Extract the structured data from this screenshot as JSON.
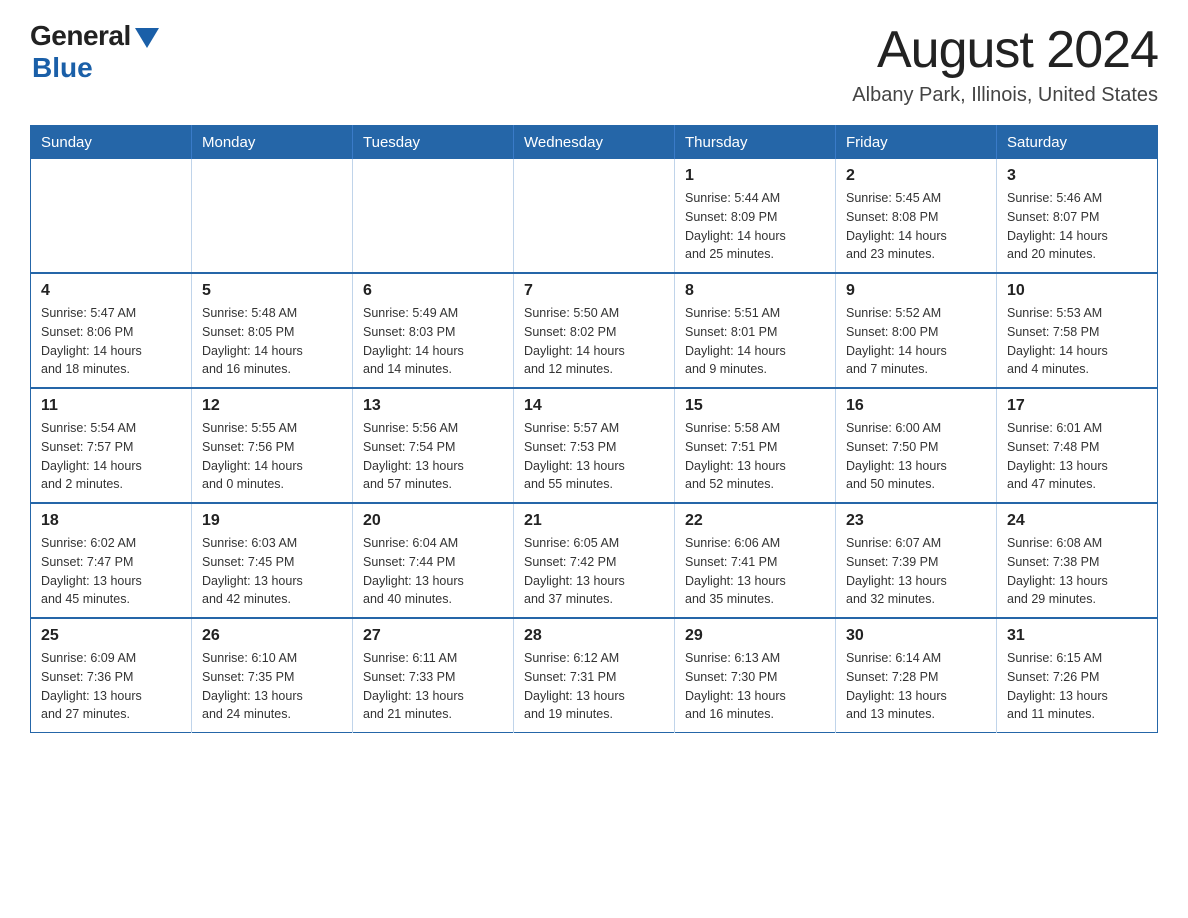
{
  "logo": {
    "general": "General",
    "blue": "Blue"
  },
  "title": "August 2024",
  "subtitle": "Albany Park, Illinois, United States",
  "weekdays": [
    "Sunday",
    "Monday",
    "Tuesday",
    "Wednesday",
    "Thursday",
    "Friday",
    "Saturday"
  ],
  "weeks": [
    [
      {
        "day": "",
        "info": ""
      },
      {
        "day": "",
        "info": ""
      },
      {
        "day": "",
        "info": ""
      },
      {
        "day": "",
        "info": ""
      },
      {
        "day": "1",
        "info": "Sunrise: 5:44 AM\nSunset: 8:09 PM\nDaylight: 14 hours\nand 25 minutes."
      },
      {
        "day": "2",
        "info": "Sunrise: 5:45 AM\nSunset: 8:08 PM\nDaylight: 14 hours\nand 23 minutes."
      },
      {
        "day": "3",
        "info": "Sunrise: 5:46 AM\nSunset: 8:07 PM\nDaylight: 14 hours\nand 20 minutes."
      }
    ],
    [
      {
        "day": "4",
        "info": "Sunrise: 5:47 AM\nSunset: 8:06 PM\nDaylight: 14 hours\nand 18 minutes."
      },
      {
        "day": "5",
        "info": "Sunrise: 5:48 AM\nSunset: 8:05 PM\nDaylight: 14 hours\nand 16 minutes."
      },
      {
        "day": "6",
        "info": "Sunrise: 5:49 AM\nSunset: 8:03 PM\nDaylight: 14 hours\nand 14 minutes."
      },
      {
        "day": "7",
        "info": "Sunrise: 5:50 AM\nSunset: 8:02 PM\nDaylight: 14 hours\nand 12 minutes."
      },
      {
        "day": "8",
        "info": "Sunrise: 5:51 AM\nSunset: 8:01 PM\nDaylight: 14 hours\nand 9 minutes."
      },
      {
        "day": "9",
        "info": "Sunrise: 5:52 AM\nSunset: 8:00 PM\nDaylight: 14 hours\nand 7 minutes."
      },
      {
        "day": "10",
        "info": "Sunrise: 5:53 AM\nSunset: 7:58 PM\nDaylight: 14 hours\nand 4 minutes."
      }
    ],
    [
      {
        "day": "11",
        "info": "Sunrise: 5:54 AM\nSunset: 7:57 PM\nDaylight: 14 hours\nand 2 minutes."
      },
      {
        "day": "12",
        "info": "Sunrise: 5:55 AM\nSunset: 7:56 PM\nDaylight: 14 hours\nand 0 minutes."
      },
      {
        "day": "13",
        "info": "Sunrise: 5:56 AM\nSunset: 7:54 PM\nDaylight: 13 hours\nand 57 minutes."
      },
      {
        "day": "14",
        "info": "Sunrise: 5:57 AM\nSunset: 7:53 PM\nDaylight: 13 hours\nand 55 minutes."
      },
      {
        "day": "15",
        "info": "Sunrise: 5:58 AM\nSunset: 7:51 PM\nDaylight: 13 hours\nand 52 minutes."
      },
      {
        "day": "16",
        "info": "Sunrise: 6:00 AM\nSunset: 7:50 PM\nDaylight: 13 hours\nand 50 minutes."
      },
      {
        "day": "17",
        "info": "Sunrise: 6:01 AM\nSunset: 7:48 PM\nDaylight: 13 hours\nand 47 minutes."
      }
    ],
    [
      {
        "day": "18",
        "info": "Sunrise: 6:02 AM\nSunset: 7:47 PM\nDaylight: 13 hours\nand 45 minutes."
      },
      {
        "day": "19",
        "info": "Sunrise: 6:03 AM\nSunset: 7:45 PM\nDaylight: 13 hours\nand 42 minutes."
      },
      {
        "day": "20",
        "info": "Sunrise: 6:04 AM\nSunset: 7:44 PM\nDaylight: 13 hours\nand 40 minutes."
      },
      {
        "day": "21",
        "info": "Sunrise: 6:05 AM\nSunset: 7:42 PM\nDaylight: 13 hours\nand 37 minutes."
      },
      {
        "day": "22",
        "info": "Sunrise: 6:06 AM\nSunset: 7:41 PM\nDaylight: 13 hours\nand 35 minutes."
      },
      {
        "day": "23",
        "info": "Sunrise: 6:07 AM\nSunset: 7:39 PM\nDaylight: 13 hours\nand 32 minutes."
      },
      {
        "day": "24",
        "info": "Sunrise: 6:08 AM\nSunset: 7:38 PM\nDaylight: 13 hours\nand 29 minutes."
      }
    ],
    [
      {
        "day": "25",
        "info": "Sunrise: 6:09 AM\nSunset: 7:36 PM\nDaylight: 13 hours\nand 27 minutes."
      },
      {
        "day": "26",
        "info": "Sunrise: 6:10 AM\nSunset: 7:35 PM\nDaylight: 13 hours\nand 24 minutes."
      },
      {
        "day": "27",
        "info": "Sunrise: 6:11 AM\nSunset: 7:33 PM\nDaylight: 13 hours\nand 21 minutes."
      },
      {
        "day": "28",
        "info": "Sunrise: 6:12 AM\nSunset: 7:31 PM\nDaylight: 13 hours\nand 19 minutes."
      },
      {
        "day": "29",
        "info": "Sunrise: 6:13 AM\nSunset: 7:30 PM\nDaylight: 13 hours\nand 16 minutes."
      },
      {
        "day": "30",
        "info": "Sunrise: 6:14 AM\nSunset: 7:28 PM\nDaylight: 13 hours\nand 13 minutes."
      },
      {
        "day": "31",
        "info": "Sunrise: 6:15 AM\nSunset: 7:26 PM\nDaylight: 13 hours\nand 11 minutes."
      }
    ]
  ]
}
